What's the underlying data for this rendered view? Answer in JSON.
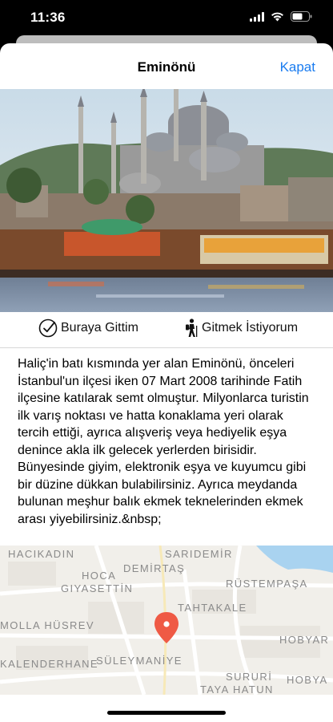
{
  "status_bar": {
    "time": "11:36",
    "icons": [
      "signal-icon",
      "wifi-icon",
      "battery-icon"
    ]
  },
  "nav": {
    "title": "Eminönü",
    "close_label": "Kapat",
    "accent_color": "#1a7cf0"
  },
  "actions": {
    "visited_label": "Buraya Gittim",
    "want_label": "Gitmek İstiyorum"
  },
  "description": "Haliç'in batı kısmında yer alan Eminönü, önceleri İstanbul'un ilçesi iken 07 Mart 2008 tarihinde Fatih ilçesine katılarak semt olmuştur. Milyonlarca turistin ilk varış noktası ve hatta konaklama yeri olarak tercih ettiği, ayrıca alışveriş veya hediyelik eşya denince akla ilk gelecek yerlerden birisidir. Bünyesinde giyim, elektronik eşya ve kuyumcu gibi bir düzine dükkan bulabilirsiniz. Ayrıca meydanda bulunan meşhur balık ekmek teknelerinden ekmek arası yiyebilirsiniz.&nbsp;",
  "map": {
    "labels": {
      "hacikadin": "HACIKADIN",
      "saridemir": "SARIDEMİR",
      "demirtas": "DEMİRTAŞ",
      "hoca": "HOCA",
      "giyasettin": "GIYASETTİN",
      "rustempasa": "RÜSTEMPAŞA",
      "tahtakale": "TAHTAKALE",
      "mollahusrev": "MOLLA HÜSREV",
      "hobyar": "HOBYAR",
      "kalenderhane": "KALENDERHANE",
      "suleymaniye": "SÜLEYMANİYE",
      "sururi": "SURURİ",
      "hobyar2": "HOBYA",
      "tayahatun": "TAYA HATUN"
    }
  }
}
